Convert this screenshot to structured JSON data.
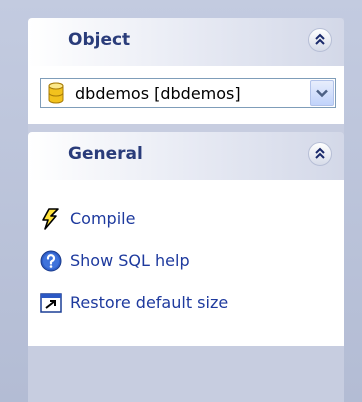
{
  "object_panel": {
    "title": "Object",
    "selected_database": "dbdemos [dbdemos]"
  },
  "general_panel": {
    "title": "General",
    "items": [
      {
        "label": "Compile",
        "icon": "lightning-icon"
      },
      {
        "label": "Show SQL help",
        "icon": "help-icon"
      },
      {
        "label": "Restore default size",
        "icon": "restore-window-icon"
      }
    ]
  },
  "colors": {
    "header_text": "#2a3c7a",
    "link_text": "#1e3a9e",
    "pane_bg": "#c7cde0"
  }
}
